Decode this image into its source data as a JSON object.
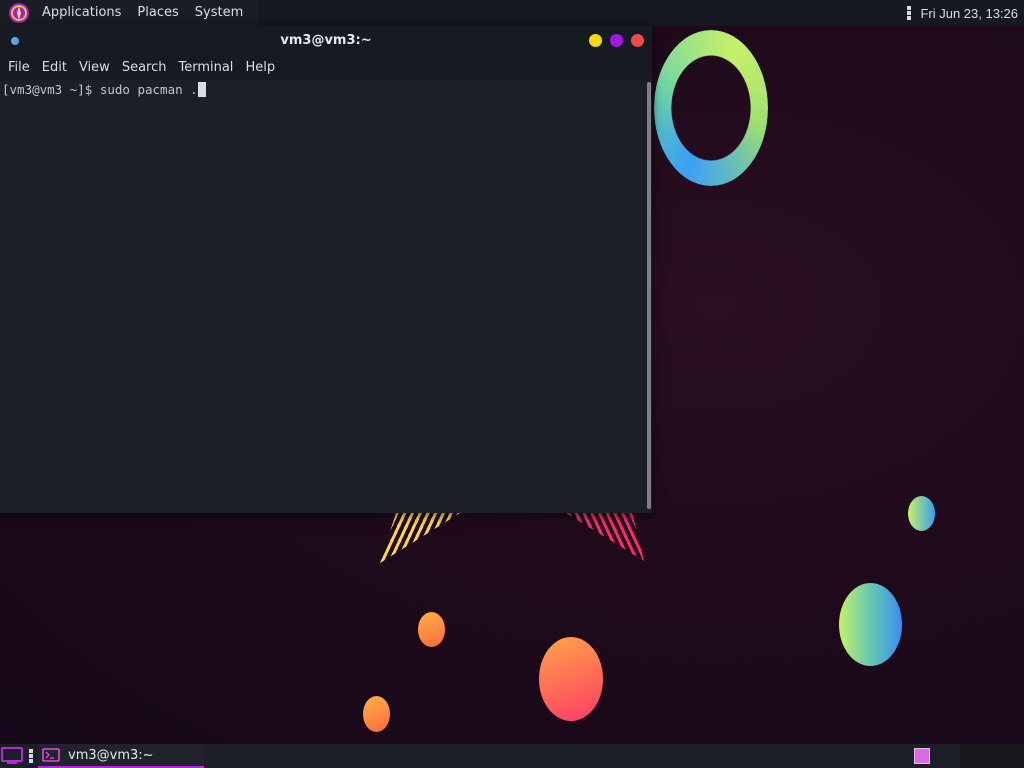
{
  "top_panel": {
    "menus": [
      "Applications",
      "Places",
      "System"
    ],
    "clock": "Fri Jun 23, 13:26"
  },
  "terminal": {
    "title": "vm3@vm3:~",
    "menu": [
      "File",
      "Edit",
      "View",
      "Search",
      "Terminal",
      "Help"
    ],
    "prompt": "[vm3@vm3 ~]$ ",
    "command": "sudo pacman ."
  },
  "taskbar": {
    "task_label": "vm3@vm3:~"
  },
  "colors": {
    "accent": "#b02ad8",
    "minimize": "#f5d90a",
    "maximize": "#a317e0",
    "close": "#f04a4a"
  }
}
